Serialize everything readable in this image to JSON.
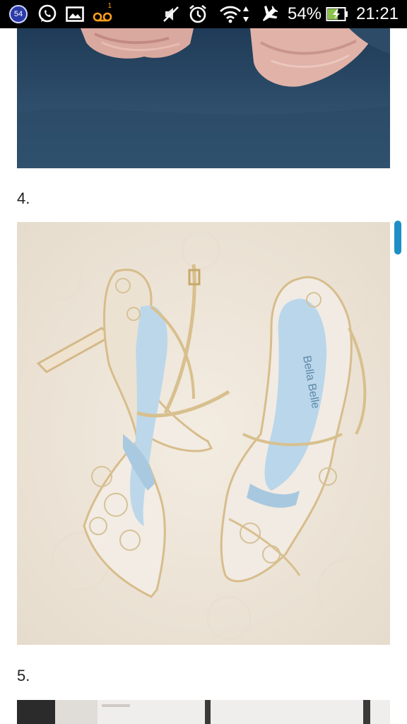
{
  "status_bar": {
    "notification_count": "54",
    "battery_percent": "54%",
    "time": "21:21",
    "voicemail_count": "1",
    "icons": [
      "notification-badge-icon",
      "whatsapp-icon",
      "gallery-icon",
      "voicemail-icon",
      "muted-icon",
      "alarm-icon",
      "wifi-icon",
      "data-arrows-icon",
      "airplane-icon",
      "battery-charging-icon"
    ]
  },
  "article": {
    "items": [
      {
        "label": "4.",
        "image_text": "Bella Belle"
      },
      {
        "label": "5."
      }
    ]
  },
  "colors": {
    "status_bar_bg": "#000000",
    "battery_green": "#8bc34a",
    "scroll_thumb": "#1e8fc6",
    "page_bg": "#ffffff"
  }
}
